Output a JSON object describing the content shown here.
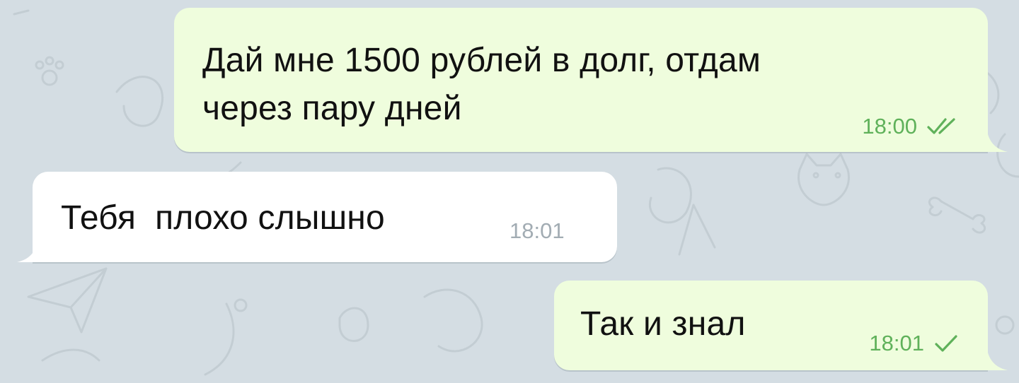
{
  "chat": {
    "messages": [
      {
        "direction": "outgoing",
        "lines": [
          "Дай мне 1500 рублей в долг, отдам",
          "через пару дней"
        ],
        "time": "18:00",
        "status": "read",
        "status_icon": "double-check-icon"
      },
      {
        "direction": "incoming",
        "lines": [
          "Тебя  плохо слышно"
        ],
        "time": "18:01"
      },
      {
        "direction": "outgoing",
        "lines": [
          "Так и знал"
        ],
        "time": "18:01",
        "status": "sent",
        "status_icon": "single-check-icon"
      }
    ]
  },
  "colors": {
    "wallpaper": "#d4dde3",
    "outgoing_bubble": "#effddd",
    "incoming_bubble": "#ffffff",
    "outgoing_meta": "#5fb15a",
    "incoming_meta": "#a2acb3"
  }
}
